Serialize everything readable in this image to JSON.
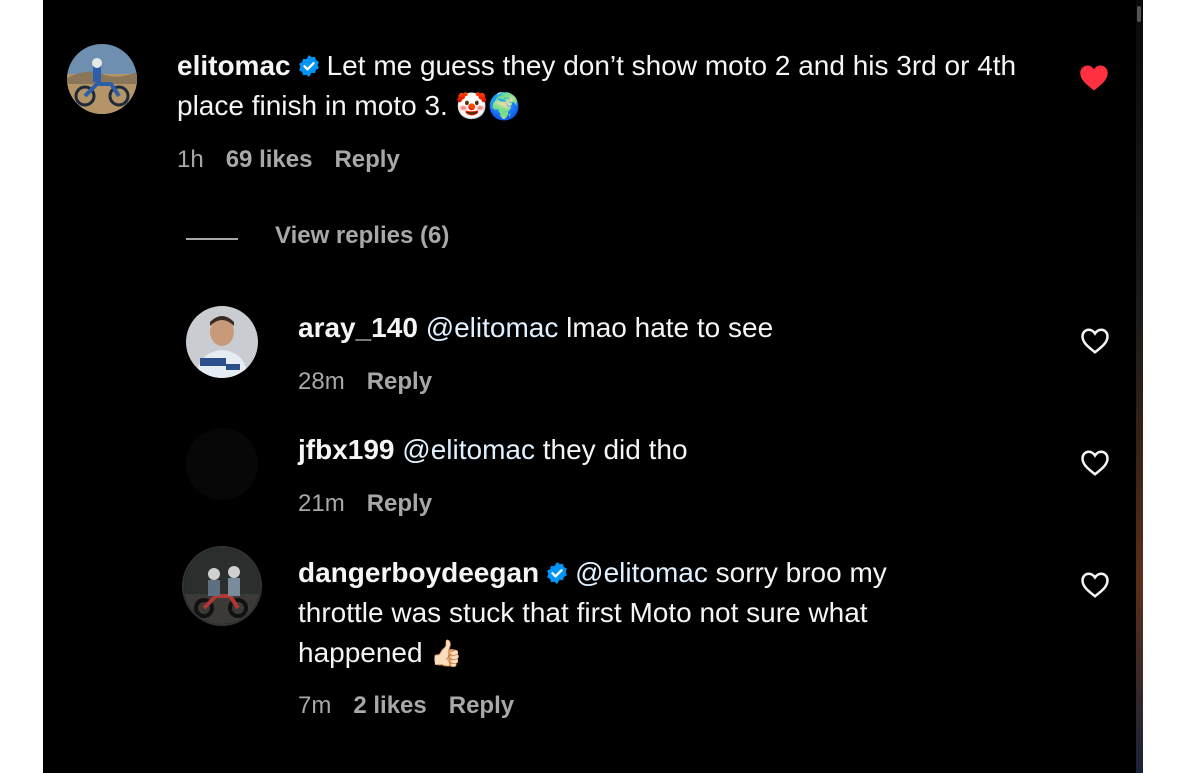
{
  "comments": [
    {
      "username": "elitomac",
      "verified": true,
      "text": "Let me guess they don’t show moto 2 and his 3rd or 4th place finish in moto 3.",
      "emoji": "🤡🌍",
      "time": "1h",
      "likes": "69 likes",
      "reply": "Reply",
      "liked": true
    }
  ],
  "view_replies": "View replies (6)",
  "replies": [
    {
      "username": "aray_140",
      "mention": "@elitomac",
      "text": "lmao hate to see",
      "time": "28m",
      "reply": "Reply"
    },
    {
      "username": "jfbx199",
      "mention": "@elitomac",
      "text": "they did tho",
      "time": "21m",
      "reply": "Reply"
    },
    {
      "username": "dangerboydeegan",
      "verified": true,
      "mention": "@elitomac",
      "text_line1": "sorry broo my",
      "text_line2": "throttle was stuck that first Moto not sure what",
      "text_line3": "happened",
      "emoji": "👍🏻",
      "time": "7m",
      "likes": "2 likes",
      "reply": "Reply"
    }
  ],
  "colors": {
    "background": "#000000",
    "text": "#f5f5f5",
    "meta": "#a8a8a8",
    "mention": "#e0f1ff",
    "verified": "#0095f6",
    "heart_liked": "#ff3040"
  }
}
